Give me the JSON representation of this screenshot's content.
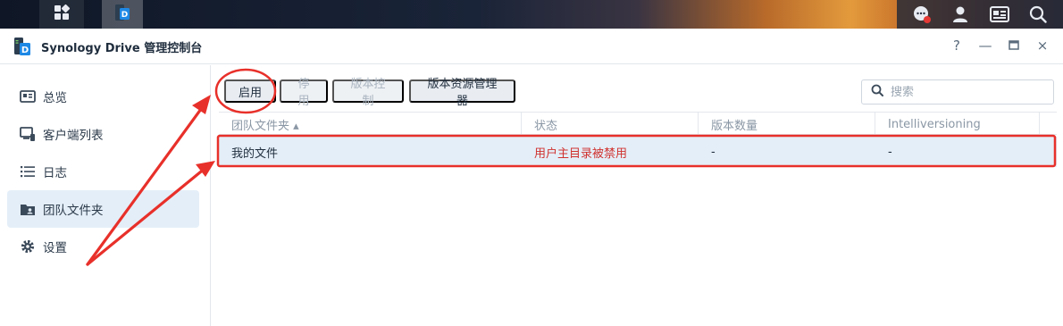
{
  "window": {
    "title": "Synology Drive 管理控制台",
    "controls": {
      "help": "?",
      "minimize": "—",
      "maximize": "□",
      "close": "×"
    }
  },
  "sidebar": {
    "items": [
      {
        "label": "总览",
        "icon": "overview-icon"
      },
      {
        "label": "客户端列表",
        "icon": "client-list-icon"
      },
      {
        "label": "日志",
        "icon": "log-icon"
      },
      {
        "label": "团队文件夹",
        "icon": "team-folder-icon",
        "active": true
      },
      {
        "label": "设置",
        "icon": "settings-gear-icon"
      }
    ]
  },
  "toolbar": {
    "enable_label": "启用",
    "disable_label": "停用",
    "version_control_label": "版本控制",
    "version_explorer_label": "版本资源管理器"
  },
  "search": {
    "placeholder": "搜索"
  },
  "table": {
    "columns": [
      "团队文件夹 ▴",
      "状态",
      "版本数量",
      "Intelliversioning"
    ],
    "rows": [
      {
        "name": "我的文件",
        "status": "用户主目录被禁用",
        "versions": "-",
        "intelliversioning": "-"
      }
    ]
  },
  "colors": {
    "accent": "#e4eef8",
    "status_error": "#d0322f",
    "annotation": "#e8302a"
  }
}
